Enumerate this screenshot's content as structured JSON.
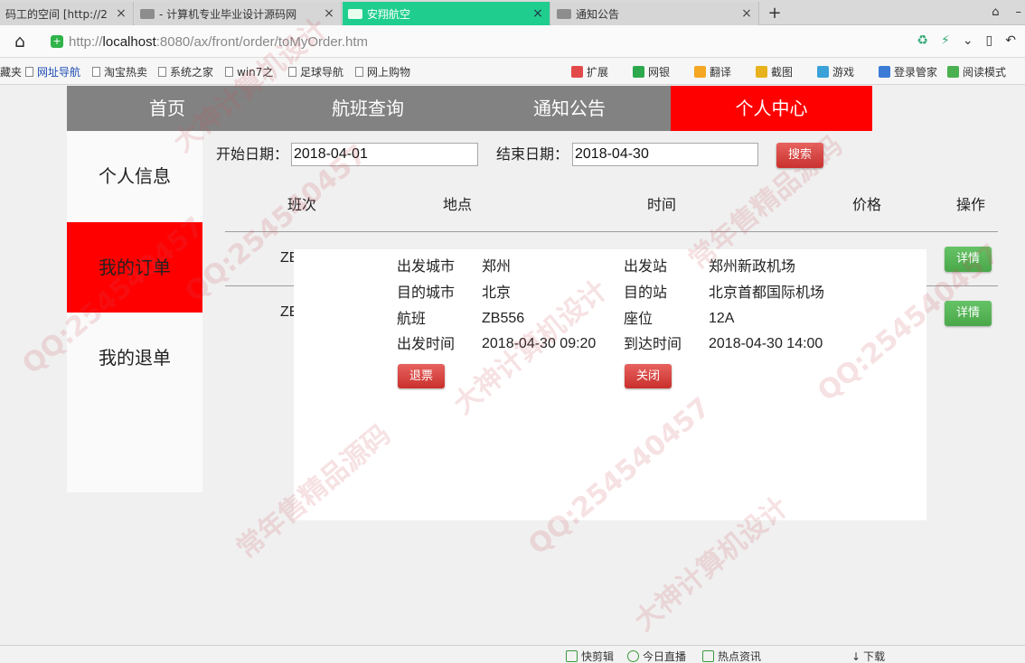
{
  "browser": {
    "tabs": [
      {
        "title": "码工的空间 [http://2",
        "active": false
      },
      {
        "title": "- 计算机专业毕业设计源码网",
        "active": false
      },
      {
        "title": "安翔航空",
        "active": true
      },
      {
        "title": "通知公告",
        "active": false
      }
    ],
    "close_glyph": "×",
    "new_tab_glyph": "+",
    "url_host": "localhost",
    "url_prefix": "http://",
    "url_rest": ":8080/ax/front/order/toMyOrder.htm",
    "bookmarks": {
      "left": [
        "藏夹",
        "网址导航",
        "淘宝热卖",
        "系统之家",
        "win7之",
        "足球导航",
        "网上购物"
      ],
      "right": [
        "扩展",
        "网银",
        "翻译",
        "截图",
        "游戏",
        "登录管家",
        "阅读模式"
      ]
    }
  },
  "nav": {
    "items": [
      "首页",
      "航班查询",
      "通知公告",
      "个人中心"
    ],
    "active_index": 3
  },
  "sidebar": {
    "items": [
      "个人信息",
      "我的订单",
      "我的退单"
    ],
    "active_index": 1
  },
  "search": {
    "start_label": "开始日期：",
    "start_value": "2018-04-01",
    "end_label": "结束日期：",
    "end_value": "2018-04-30",
    "button": "搜索"
  },
  "table": {
    "headers": [
      "班次",
      "地点",
      "时间",
      "价格",
      "操作"
    ],
    "rows": [
      {
        "trip": "ZE",
        "action": "详情"
      },
      {
        "trip": "ZE",
        "action": "详情"
      }
    ]
  },
  "detail": {
    "depart_city_label": "出发城市",
    "depart_city": "郑州",
    "depart_station_label": "出发站",
    "depart_station": "郑州新政机场",
    "dest_city_label": "目的城市",
    "dest_city": "北京",
    "dest_station_label": "目的站",
    "dest_station": "北京首都国际机场",
    "flight_label": "航班",
    "flight": "ZB556",
    "seat_label": "座位",
    "seat": "12A",
    "depart_time_label": "出发时间",
    "depart_time": "2018-04-30 09:20",
    "arrive_time_label": "到达时间",
    "arrive_time": "2018-04-30 14:00",
    "refund_button": "退票",
    "close_button": "关闭"
  },
  "watermarks": [
    "QQ:254540457",
    "大神计算机设计",
    "常年售精品源码"
  ],
  "statusbar": [
    "快剪辑",
    "今日直播",
    "热点资讯",
    "下载"
  ],
  "colors": {
    "nav_bg": "#828282",
    "active_red": "#ff0000",
    "active_tab": "#1fce8f",
    "button_red": "#d9534f",
    "button_green": "#5cb85c"
  }
}
